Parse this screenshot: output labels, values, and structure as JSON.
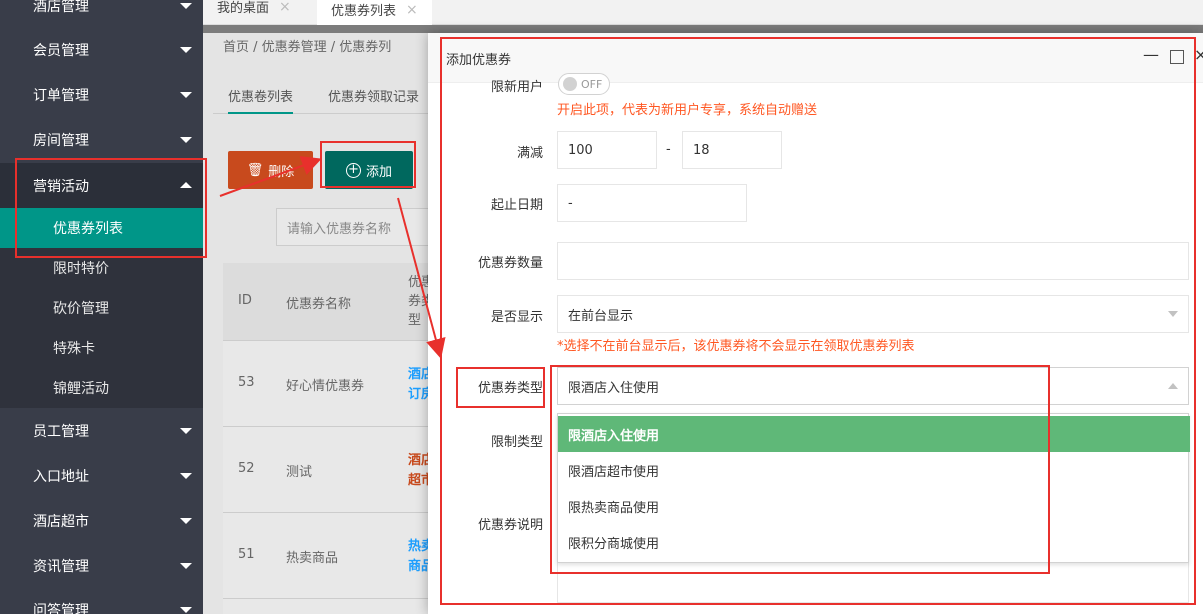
{
  "sidebar": {
    "items": [
      {
        "label": "酒店管理"
      },
      {
        "label": "会员管理"
      },
      {
        "label": "订单管理"
      },
      {
        "label": "房间管理"
      },
      {
        "label": "营销活动"
      },
      {
        "label": "员工管理"
      },
      {
        "label": "入口地址"
      },
      {
        "label": "酒店超市"
      },
      {
        "label": "资讯管理"
      },
      {
        "label": "问答管理"
      }
    ],
    "sub_items": [
      {
        "label": "优惠券列表"
      },
      {
        "label": "限时特价"
      },
      {
        "label": "砍价管理"
      },
      {
        "label": "特殊卡"
      },
      {
        "label": "锦鲤活动"
      }
    ]
  },
  "tabs": [
    {
      "label": "我的桌面"
    },
    {
      "label": "优惠券列表"
    }
  ],
  "main": {
    "breadcrumb": "首页  /  优惠券管理  /  优惠券列",
    "subtabs": [
      "优惠卷列表",
      "优惠券领取记录"
    ],
    "delete_label": "删除",
    "add_label": "添加",
    "search_placeholder": "请输入优惠券名称",
    "table": {
      "headers": [
        "ID",
        "优惠券名称",
        "优惠券类型"
      ],
      "header_type_lines": [
        "优惠",
        "券类",
        "型"
      ],
      "rows": [
        {
          "id": "53",
          "name": "好心情优惠券",
          "type": [
            "酒店",
            "订房"
          ]
        },
        {
          "id": "52",
          "name": "测试",
          "type": [
            "酒店",
            "超市"
          ]
        },
        {
          "id": "51",
          "name": "热卖商品",
          "type": [
            "热卖",
            "商品"
          ]
        }
      ]
    }
  },
  "dialog": {
    "title": "添加优惠券",
    "new_user_label": "限新用户",
    "switch_text": "OFF",
    "new_user_hint": "开启此项，代表为新用户专享，系统自动赠送",
    "full_reduce_label": "满减",
    "full_value": "100",
    "dash": "-",
    "reduce_value": "18",
    "date_label": "起止日期",
    "date_value": "-",
    "quantity_label": "优惠券数量",
    "show_label": "是否显示",
    "show_value": "在前台显示",
    "show_hint": "*选择不在前台显示后，该优惠券将不会显示在领取优惠券列表",
    "type_label": "优惠券类型",
    "type_value": "限酒店入住使用",
    "limit_label": "限制类型",
    "desc_label": "优惠券说明",
    "type_options": [
      {
        "label": "限酒店入住使用",
        "selected": true
      },
      {
        "label": "限酒店超市使用"
      },
      {
        "label": "限热卖商品使用"
      },
      {
        "label": "限积分商城使用"
      }
    ]
  },
  "colors": {
    "sidebar_bg": "#393d49",
    "active_green": "#009688",
    "option_green": "#5fb878",
    "hint_orange": "#ff5722",
    "annotation_red": "#e8302c"
  }
}
